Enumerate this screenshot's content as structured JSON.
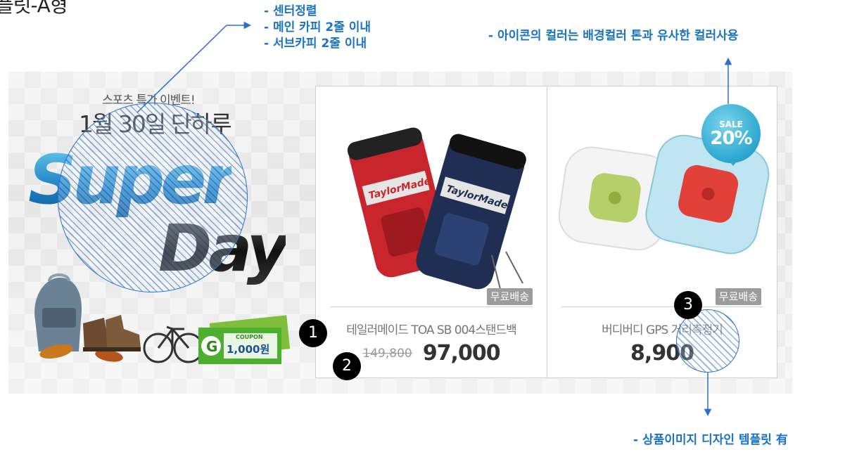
{
  "page": {
    "corner_title": "플릿-A형"
  },
  "annotations": {
    "left": [
      "- 센터정렬",
      "- 메인 카피 2줄 이내",
      "- 서브카피 2줄 이내"
    ],
    "right": "- 아이콘의 컬러는 배경컬러 톤과 유사한 컬러사용",
    "bottom": "- 상품이미지 디자인 템플릿 有"
  },
  "promo": {
    "subtitle": "스포츠 특가 이벤트!",
    "date_headline": "1월 30일 단하루",
    "logo_line1": "Super",
    "logo_line2": "Day",
    "coupon_label": "COUPON",
    "coupon_amount": "1,000원"
  },
  "products": [
    {
      "brand_text": "TaylorMade",
      "shipping_badge": "무료배송",
      "name": "테일러메이드 TOA SB 004스탠드백",
      "original_price": "149,800",
      "price": "97,000"
    },
    {
      "shipping_badge": "무료배송",
      "name": "버디버디 GPS 거리측정기",
      "price": "8,900",
      "sale_badge_top": "SALE",
      "sale_badge_pct": "20%"
    }
  ],
  "markers": [
    "1",
    "2",
    "3"
  ],
  "colors": {
    "annotation_blue": "#1a73c7",
    "hatch_blue": "#2d6fcf",
    "sale_cyan": "#2da6cf",
    "bag_red": "#c8262c",
    "bag_navy": "#1f2e52"
  },
  "icons": {
    "sale_badge": "sale-bubble-icon",
    "markers": "numbered-circle-icon"
  }
}
